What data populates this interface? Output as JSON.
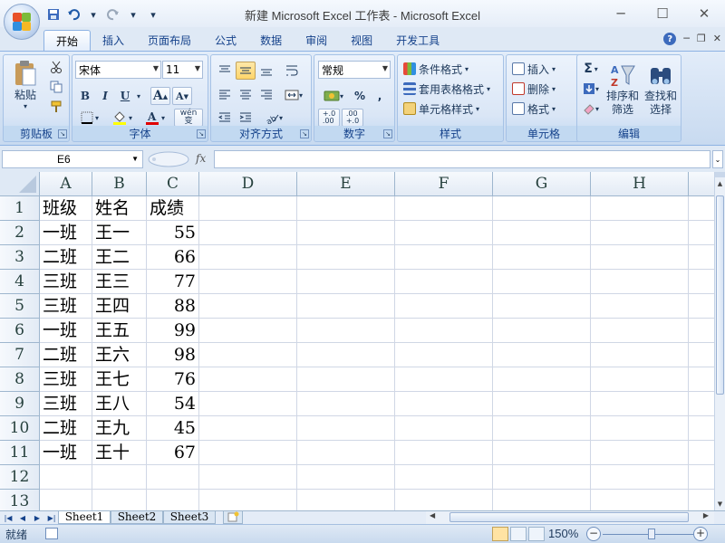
{
  "window": {
    "title": "新建 Microsoft Excel 工作表 - Microsoft Excel",
    "minimize_icon": "minimize-icon",
    "maximize_icon": "maximize-icon",
    "close_icon": "close-icon"
  },
  "qat": {
    "save_icon": "save-icon",
    "undo_icon": "undo-icon",
    "redo_icon": "redo-icon",
    "customize_icon": "dropdown-icon"
  },
  "tabs": [
    "开始",
    "插入",
    "页面布局",
    "公式",
    "数据",
    "审阅",
    "视图",
    "开发工具"
  ],
  "active_tab": "开始",
  "ribbon": {
    "clipboard": {
      "label": "剪贴板",
      "paste": "粘贴"
    },
    "font": {
      "label": "字体",
      "font_name": "宋体",
      "font_size": "11",
      "bold": "B",
      "italic": "I",
      "underline": "U",
      "grow": "A",
      "shrink": "A",
      "phonetic": "wén\n变"
    },
    "alignment": {
      "label": "对齐方式"
    },
    "number": {
      "label": "数字",
      "format": "常规",
      "percent": "%",
      "comma": ",",
      "inc_decimal": "+.0\n.00",
      "dec_decimal": ".00\n+.0"
    },
    "styles": {
      "label": "样式",
      "conditional": "条件格式",
      "table": "套用表格格式",
      "cell_styles": "单元格样式"
    },
    "cells": {
      "label": "单元格",
      "insert": "插入",
      "delete": "删除",
      "format": "格式"
    },
    "editing": {
      "label": "编辑",
      "sum": "Σ",
      "sort_filter": "排序和\n筛选",
      "find_select": "查找和\n选择"
    }
  },
  "formula_bar": {
    "name_box": "E6",
    "fx": "fx",
    "formula": ""
  },
  "columns": [
    "A",
    "B",
    "C",
    "D",
    "E",
    "F",
    "G",
    "H"
  ],
  "rows": [
    {
      "n": "1",
      "cells": [
        "班级",
        "姓名",
        "成绩"
      ]
    },
    {
      "n": "2",
      "cells": [
        "一班",
        "王一",
        "55"
      ]
    },
    {
      "n": "3",
      "cells": [
        "二班",
        "王二",
        "66"
      ]
    },
    {
      "n": "4",
      "cells": [
        "三班",
        "王三",
        "77"
      ]
    },
    {
      "n": "5",
      "cells": [
        "三班",
        "王四",
        "88"
      ]
    },
    {
      "n": "6",
      "cells": [
        "一班",
        "王五",
        "99"
      ]
    },
    {
      "n": "7",
      "cells": [
        "二班",
        "王六",
        "98"
      ]
    },
    {
      "n": "8",
      "cells": [
        "三班",
        "王七",
        "76"
      ]
    },
    {
      "n": "9",
      "cells": [
        "三班",
        "王八",
        "54"
      ]
    },
    {
      "n": "10",
      "cells": [
        "二班",
        "王九",
        "45"
      ]
    },
    {
      "n": "11",
      "cells": [
        "一班",
        "王十",
        "67"
      ]
    },
    {
      "n": "12",
      "cells": [
        "",
        "",
        ""
      ]
    },
    {
      "n": "13",
      "cells": [
        "",
        "",
        ""
      ]
    }
  ],
  "sheets": [
    "Sheet1",
    "Sheet2",
    "Sheet3"
  ],
  "active_sheet": "Sheet1",
  "status": {
    "ready": "就绪",
    "zoom": "150%",
    "zoom_out": "−",
    "zoom_in": "+"
  },
  "colors": {
    "accent": "#15428b",
    "ribbon_bg": "#dae6f6",
    "pressed": "#ffd56a",
    "grid_line": "#d0d7e5"
  }
}
